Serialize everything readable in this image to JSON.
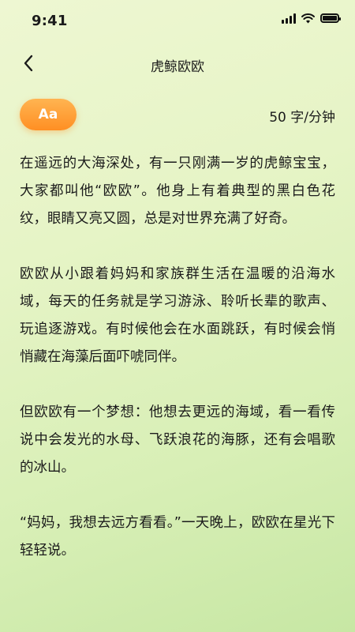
{
  "status_bar": {
    "time": "9:41"
  },
  "nav": {
    "back_icon": "chevron-left-icon",
    "title": "虎鲸欧欧"
  },
  "toolbar": {
    "font_button_label": "Aa",
    "font_button_color": "#ff9a2e",
    "speed_label": "50 字/分钟"
  },
  "story": {
    "paragraphs": [
      "在遥远的大海深处，有一只刚满一岁的虎鲸宝宝，大家都叫他“欧欧”。他身上有着典型的黑白色花纹，眼睛又亮又圆，总是对世界充满了好奇。",
      "欧欧从小跟着妈妈和家族群生活在温暖的沿海水域，每天的任务就是学习游泳、聆听长辈的歌声、玩追逐游戏。有时候他会在水面跳跃，有时候会悄悄藏在海藻后面吓唬同伴。",
      "但欧欧有一个梦想：他想去更远的海域，看一看传说中会发光的水母、飞跃浪花的海豚，还有会唱歌的冰山。",
      "“妈妈，我想去远方看看。”一天晚上，欧欧在星光下轻轻说。"
    ]
  }
}
